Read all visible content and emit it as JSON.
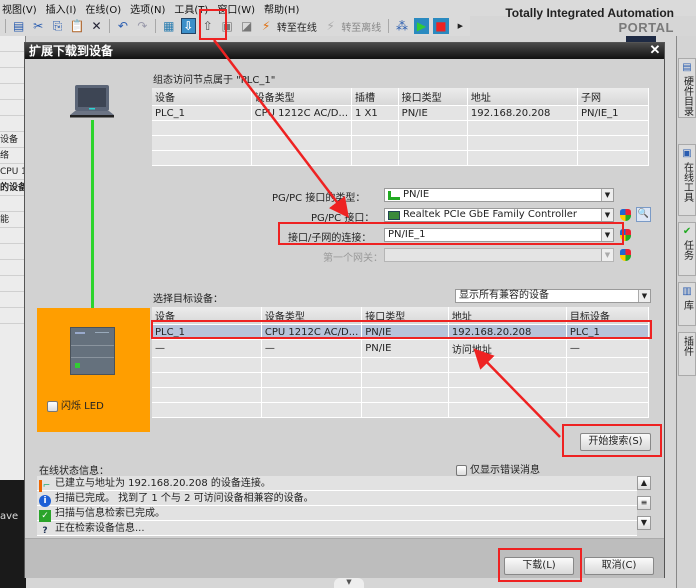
{
  "menu": [
    "视图(V)",
    "插入(I)",
    "在线(O)",
    "选项(N)",
    "工具(T)",
    "窗口(W)",
    "帮助(H)"
  ],
  "toolbar": {
    "go_online": "转至在线",
    "go_offline": "转至离线"
  },
  "brand": {
    "line1": "Totally Integrated Automation",
    "line2": "PORTAL"
  },
  "left_panel": [
    "",
    "",
    "",
    "",
    "",
    "",
    "设备",
    "络",
    "CPU 1",
    "的设备",
    "",
    "能",
    "",
    "",
    "",
    "",
    "",
    "",
    ""
  ],
  "background_left_text": "ave",
  "right_tabs": [
    "硬件目录",
    "在线工具",
    "任务",
    "库",
    "插件"
  ],
  "dialog": {
    "title": "扩展下载到设备",
    "config_label": "组态访问节点属于 \"PLC_1\"",
    "config_table": {
      "headers": [
        "设备",
        "设备类型",
        "插槽",
        "接口类型",
        "地址",
        "子网"
      ],
      "rows": [
        [
          "PLC_1",
          "CPU 1212C AC/D...",
          "1 X1",
          "PN/IE",
          "192.168.20.208",
          "PN/IE_1"
        ],
        [
          "",
          "",
          "",
          "",
          "",
          ""
        ],
        [
          "",
          "",
          "",
          "",
          "",
          ""
        ],
        [
          "",
          "",
          "",
          "",
          "",
          ""
        ]
      ]
    },
    "pgpc_type_label": "PG/PC 接口的类型：",
    "pgpc_type_value": "PN/IE",
    "pgpc_iface_label": "PG/PC 接口：",
    "pgpc_iface_value": "Realtek PCIe GbE Family Controller",
    "subnet_conn_label": "接口/子网的连接：",
    "subnet_conn_value": "PN/IE_1",
    "gateway_label": "第一个网关：",
    "gateway_value": "",
    "select_target_label": "选择目标设备：",
    "filter_value": "显示所有兼容的设备",
    "target_table": {
      "headers": [
        "设备",
        "设备类型",
        "接口类型",
        "地址",
        "目标设备"
      ],
      "rows": [
        [
          "PLC_1",
          "CPU 1212C AC/D...",
          "PN/IE",
          "192.168.20.208",
          "PLC_1"
        ],
        [
          "—",
          "—",
          "PN/IE",
          "访问地址",
          "—"
        ],
        [
          "",
          "",
          "",
          "",
          ""
        ],
        [
          "",
          "",
          "",
          "",
          ""
        ],
        [
          "",
          "",
          "",
          "",
          ""
        ],
        [
          "",
          "",
          "",
          "",
          ""
        ]
      ]
    },
    "flash_led_label": "闪烁 LED",
    "start_search_button": "开始搜索(S)",
    "online_status_label": "在线状态信息：",
    "only_errors_label": "仅显示错误消息",
    "status_messages": [
      {
        "icon": "connection-icon",
        "text": "已建立与地址为 192.168.20.208 的设备连接。"
      },
      {
        "icon": "info-icon",
        "text": "扫描已完成。 找到了 1 个与 2 可访问设备相兼容的设备。"
      },
      {
        "icon": "check-icon",
        "text": "扫描与信息检索已完成。"
      },
      {
        "icon": "search-device-icon",
        "text": "正在检索设备信息..."
      }
    ],
    "download_button": "下载(L)",
    "cancel_button": "取消(C)"
  },
  "colors": {
    "target_highlight": "#ff9e00",
    "link_line": "#2bd42b",
    "annotation_red": "#ee2222",
    "selected_row": "#b7c3da"
  }
}
